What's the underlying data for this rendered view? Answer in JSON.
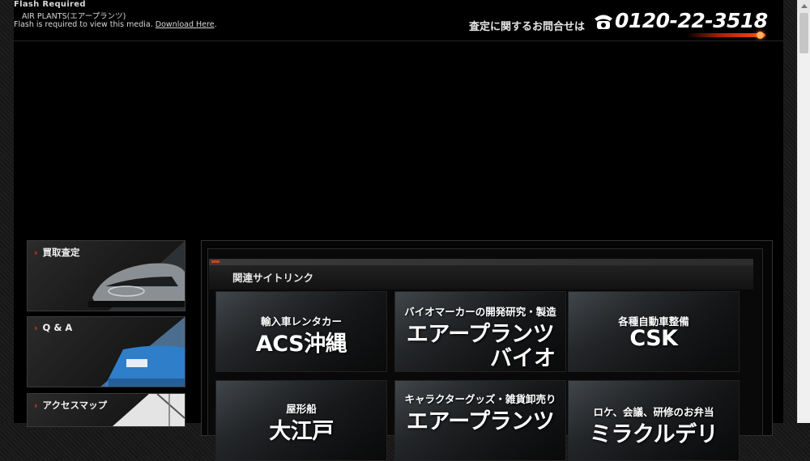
{
  "flash": {
    "title": "Flash Required",
    "subtitle": "AIR PLANTS(エアープランツ)",
    "message": "Flash is required to view this media.",
    "link": "Download Here",
    "tail": "."
  },
  "header": {
    "phone_lead": "査定に関するお問合せは",
    "phone_number": "0120-22-3518",
    "phone_icon": "telephone-icon",
    "accent_color": "#e03a1a"
  },
  "sidebar": {
    "items": [
      {
        "label": "買取査定"
      },
      {
        "label": "Q & A"
      },
      {
        "label": "アクセスマップ"
      }
    ]
  },
  "related": {
    "title": "関連サイトリンク",
    "tiles": [
      {
        "line1": "輸入車レンタカー",
        "line2": "ACS沖縄"
      },
      {
        "line1": "バイオマーカーの開発研究・製造",
        "line2": "エアープランツ",
        "line3": "バイオ"
      },
      {
        "line1": "各種自動車整備",
        "line2": "CSK"
      },
      {
        "line1": "屋形船",
        "line2": "大江戸"
      },
      {
        "line1": "キャラクターグッズ・雑貨卸売り",
        "line2": "エアープランツ"
      },
      {
        "line1": "ロケ、会議、研修のお弁当",
        "line2": "ミラクルデリ"
      }
    ]
  }
}
